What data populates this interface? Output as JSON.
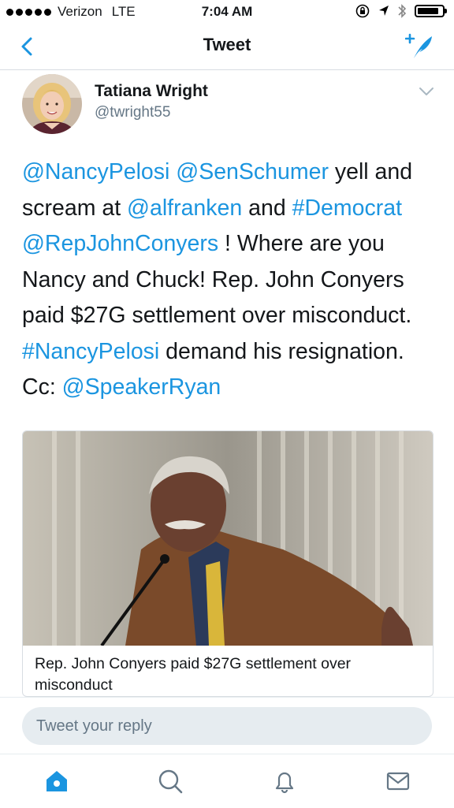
{
  "status_bar": {
    "carrier": "Verizon",
    "network": "LTE",
    "time": "7:04 AM",
    "icons": [
      "orientation-lock-icon",
      "location-icon",
      "bluetooth-icon",
      "battery-icon"
    ]
  },
  "nav": {
    "title": "Tweet",
    "back_icon": "chevron-left-icon",
    "compose_icon": "compose-tweet-icon"
  },
  "tweet": {
    "author_name": "Tatiana Wright",
    "author_handle": "@twright55",
    "text_segments": [
      {
        "text": "@NancyPelosi",
        "link": true
      },
      {
        "text": " ",
        "link": false
      },
      {
        "text": "@SenSchumer",
        "link": true
      },
      {
        "text": " yell and scream at ",
        "link": false
      },
      {
        "text": "@alfranken",
        "link": true
      },
      {
        "text": " and ",
        "link": false
      },
      {
        "text": "#Democrat",
        "link": true
      },
      {
        "text": " ",
        "link": false
      },
      {
        "text": "@RepJohnConyers",
        "link": true
      },
      {
        "text": " ! Where are you Nancy and Chuck! Rep. John Conyers paid $27G settlement over misconduct.  ",
        "link": false
      },
      {
        "text": "#NancyPelosi",
        "link": true
      },
      {
        "text": " demand his resignation. Cc: ",
        "link": false
      },
      {
        "text": "@SpeakerRyan",
        "link": true
      }
    ]
  },
  "card": {
    "title": "Rep. John Conyers paid $27G settlement over misconduct"
  },
  "reply": {
    "placeholder": "Tweet your reply"
  },
  "tab_bar": {
    "items": [
      {
        "icon": "home-icon",
        "active": true
      },
      {
        "icon": "search-icon",
        "active": false
      },
      {
        "icon": "notifications-bell-icon",
        "active": false
      },
      {
        "icon": "messages-envelope-icon",
        "active": false
      }
    ]
  },
  "colors": {
    "link": "#1b95e0",
    "text": "#14171a",
    "secondary": "#657786",
    "divider": "#d8dde2"
  }
}
